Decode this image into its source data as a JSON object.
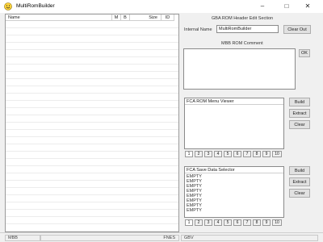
{
  "window": {
    "title": "MultiRomBuilder",
    "minimize_glyph": "–",
    "maximize_glyph": "□",
    "close_glyph": "✕"
  },
  "rom_list": {
    "columns": [
      "Name",
      "M",
      "B",
      "Size",
      "ID"
    ]
  },
  "header_edit": {
    "title": "GBA ROM Header Edit Section",
    "internal_name_label": "Internal Name",
    "internal_name_value": "MultiRomBuilder",
    "clear_out_label": "Clear Out"
  },
  "mb_comment": {
    "title": "MBB ROM Comment",
    "ok_label": "OK"
  },
  "rom_menu": {
    "title": "FCA ROM Menu Viewer",
    "build_label": "Build",
    "extract_label": "Extract",
    "clear_label": "Clear",
    "tabs": [
      "1",
      "2",
      "3",
      "4",
      "5",
      "6",
      "7",
      "8",
      "9",
      "10"
    ]
  },
  "save_selector": {
    "title": "FCA Save Data Selector",
    "build_label": "Build",
    "extract_label": "Extract",
    "clear_label": "Clear",
    "slots": [
      "EMPTY",
      "EMPTY",
      "EMPTY",
      "EMPTY",
      "EMPTY",
      "EMPTY",
      "EMPTY",
      "EMPTY"
    ],
    "tabs": [
      "1",
      "2",
      "3",
      "4",
      "5",
      "6",
      "7",
      "8",
      "9",
      "10"
    ]
  },
  "statusbar": {
    "mbb": "MBB",
    "fnes": "FNES",
    "gbv": "GBV"
  },
  "colors": {
    "title_bar": "#ffffff",
    "window_background": "#f0f0f0",
    "button_face": "#e1e1e1",
    "icon_yellow": "#ffd43b"
  }
}
